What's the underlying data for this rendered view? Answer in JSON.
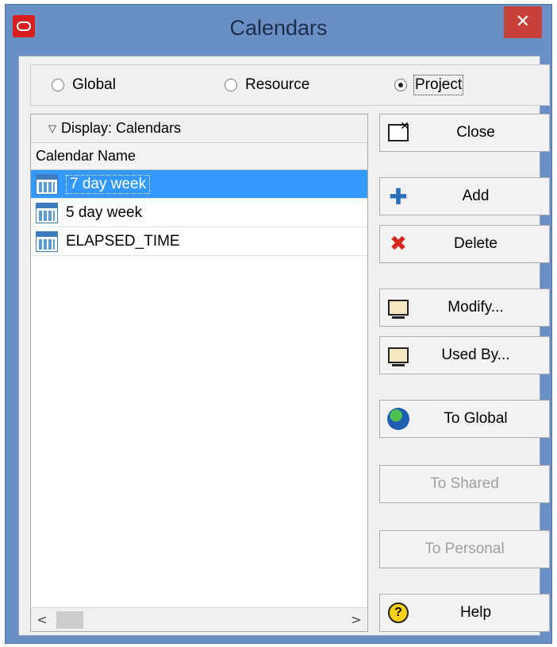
{
  "window": {
    "title": "Calendars",
    "close_glyph": "✕",
    "app_icon": "oracle-logo-icon"
  },
  "scope": {
    "options": [
      {
        "label": "Global",
        "checked": false
      },
      {
        "label": "Resource",
        "checked": false
      },
      {
        "label": "Project",
        "checked": true
      }
    ]
  },
  "list": {
    "display_label": "Display: Calendars",
    "column_header": "Calendar Name",
    "rows": [
      {
        "name": "7 day week",
        "selected": true
      },
      {
        "name": "5 day week",
        "selected": false
      },
      {
        "name": "ELAPSED_TIME",
        "selected": false
      }
    ],
    "scroll_left": "<",
    "scroll_right": ">"
  },
  "buttons": {
    "close": {
      "label": "Close",
      "icon": "close-window-icon",
      "enabled": true
    },
    "add": {
      "label": "Add",
      "icon": "add-icon",
      "enabled": true
    },
    "delete": {
      "label": "Delete",
      "icon": "delete-icon",
      "enabled": true
    },
    "modify": {
      "label": "Modify...",
      "icon": "monitor-icon",
      "enabled": true
    },
    "used_by": {
      "label": "Used By...",
      "icon": "monitor-icon",
      "enabled": true
    },
    "to_global": {
      "label": "To Global",
      "icon": "globe-icon",
      "enabled": true
    },
    "to_shared": {
      "label": "To Shared",
      "enabled": false
    },
    "to_personal": {
      "label": "To Personal",
      "enabled": false
    },
    "help": {
      "label": "Help",
      "icon": "help-icon",
      "enabled": true
    }
  }
}
